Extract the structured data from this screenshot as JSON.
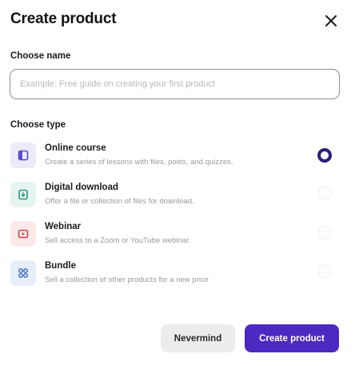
{
  "dialog": {
    "title": "Create product",
    "close_icon": "close-icon"
  },
  "name_section": {
    "label": "Choose name",
    "placeholder": "Example: Free guide on creating your first product",
    "value": ""
  },
  "type_section": {
    "label": "Choose type",
    "selected": "Online course",
    "options": [
      {
        "title": "Online course",
        "description": "Create a series of lessons with files, posts, and quizzes.",
        "icon": "course-icon",
        "icon_bg": "#ecebfa",
        "icon_color": "#5b4fd0",
        "selected": true
      },
      {
        "title": "Digital download",
        "description": "Offer a file or collection of files for download.",
        "icon": "download-icon",
        "icon_bg": "#e6f4f1",
        "icon_color": "#2f9a86",
        "selected": false
      },
      {
        "title": "Webinar",
        "description": "Sell access to a Zoom or YouTube webinar.",
        "icon": "webinar-icon",
        "icon_bg": "#fbe9ea",
        "icon_color": "#d2434b",
        "selected": false
      },
      {
        "title": "Bundle",
        "description": "Sell a collection of other products for a new price",
        "icon": "bundle-icon",
        "icon_bg": "#e8eef9",
        "icon_color": "#4a72c4",
        "selected": false
      }
    ]
  },
  "actions": {
    "cancel_label": "Nevermind",
    "submit_label": "Create product"
  },
  "colors": {
    "primary": "#4c2ac2",
    "radio_selected": "#2b1f7a"
  }
}
